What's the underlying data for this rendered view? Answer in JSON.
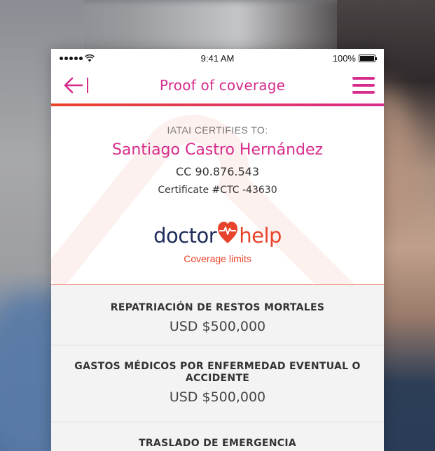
{
  "status_bar": {
    "time": "9:41 AM",
    "battery": "100%",
    "battery_level": 1.0
  },
  "nav": {
    "title": "Proof of coverage"
  },
  "certificate": {
    "certifies_label": "IATAI CERTIFIES TO:",
    "holder_name": "Santiago Castro Hernández",
    "document_id": "CC 90.876.543",
    "certificate_number": "Certificate #CTC -43630"
  },
  "brand": {
    "part1": "doctor",
    "part2": "help",
    "color_primary": "#1f2c5c",
    "color_accent": "#e8442b"
  },
  "coverage_limits_label": "Coverage limits",
  "coverages": [
    {
      "name": "REPATRIACIÓN DE RESTOS MORTALES",
      "amount": "USD $500,000"
    },
    {
      "name": "GASTOS MÉDICOS POR ENFERMEDAD EVENTUAL O ACCIDENTE",
      "amount": "USD $500,000"
    },
    {
      "name": "TRASLADO DE EMERGENCIA"
    }
  ],
  "colors": {
    "accent_pink": "#d62c8c",
    "accent_orange": "#e8442b"
  },
  "icons": {
    "back": "arrow-left-icon",
    "menu": "hamburger-menu-icon",
    "wifi": "wifi-icon",
    "battery": "battery-icon",
    "heart": "heart-pulse-icon"
  }
}
